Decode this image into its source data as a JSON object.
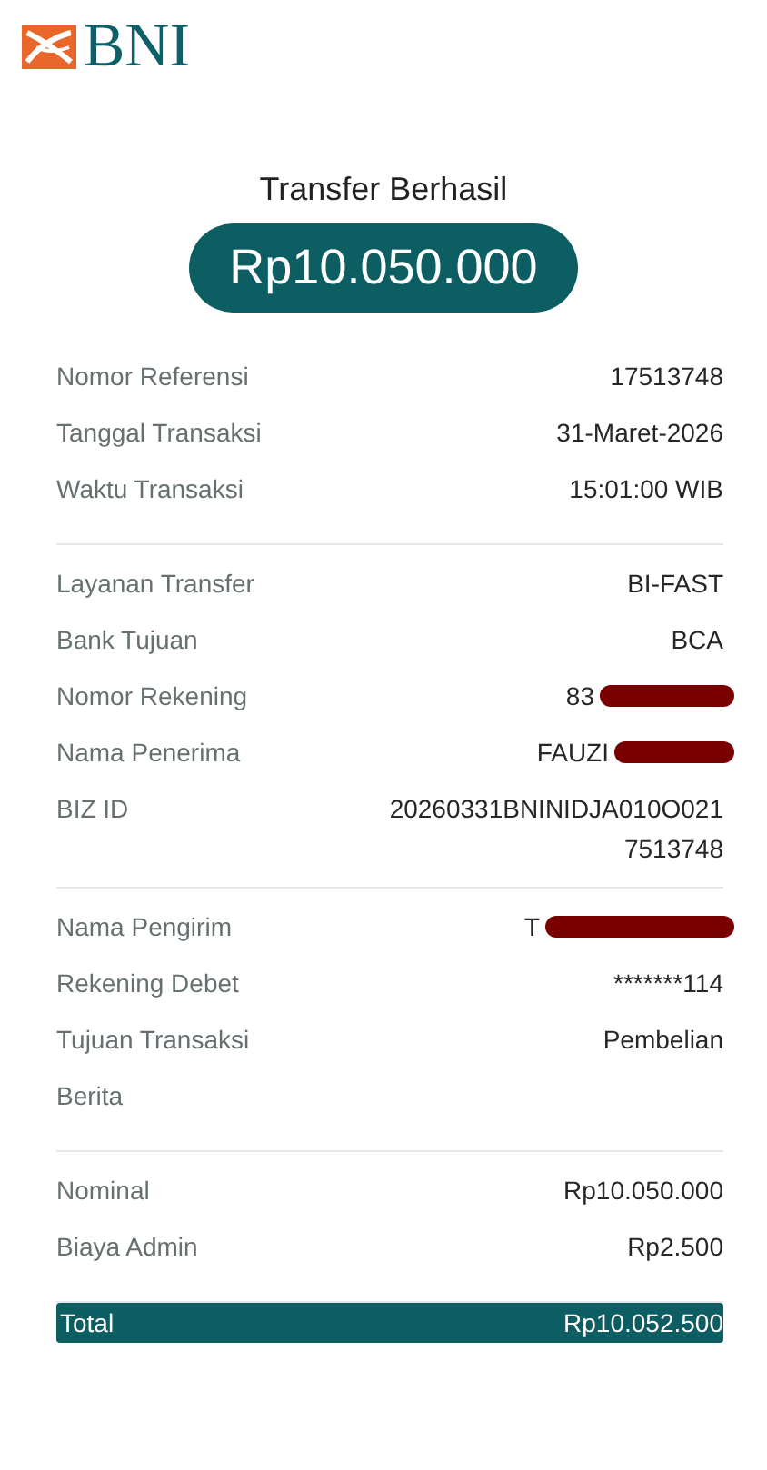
{
  "logo": {
    "text": "BNI"
  },
  "title": "Transfer Berhasil",
  "amount": "Rp10.050.000",
  "sections": [
    {
      "rows": [
        {
          "label": "Nomor Referensi",
          "value": "17513748"
        },
        {
          "label": "Tanggal Transaksi",
          "value": "31-Maret-2026"
        },
        {
          "label": "Waktu Transaksi",
          "value": "15:01:00 WIB"
        }
      ]
    },
    {
      "rows": [
        {
          "label": "Layanan Transfer",
          "value": "BI-FAST"
        },
        {
          "label": "Bank Tujuan",
          "value": "BCA"
        },
        {
          "label": "Nomor Rekening",
          "value": "83",
          "redacted": true
        },
        {
          "label": "Nama Penerima",
          "value": "FAUZI",
          "redacted": true
        },
        {
          "label": "BIZ ID",
          "value": "20260331BNINIDJA010O0217513748",
          "kind": "wrap"
        }
      ]
    },
    {
      "rows": [
        {
          "label": "Nama Pengirim",
          "value": "T",
          "redacted": true
        },
        {
          "label": "Rekening Debet",
          "value": "*******114"
        },
        {
          "label": "Tujuan Transaksi",
          "value": "Pembelian"
        },
        {
          "label": "Berita"
        }
      ]
    },
    {
      "rows": [
        {
          "label": "Nominal",
          "value": "Rp10.050.000"
        },
        {
          "label": "Biaya Admin",
          "value": "Rp2.500"
        }
      ]
    }
  ],
  "total": {
    "label": "Total",
    "value": "Rp10.052.500"
  }
}
